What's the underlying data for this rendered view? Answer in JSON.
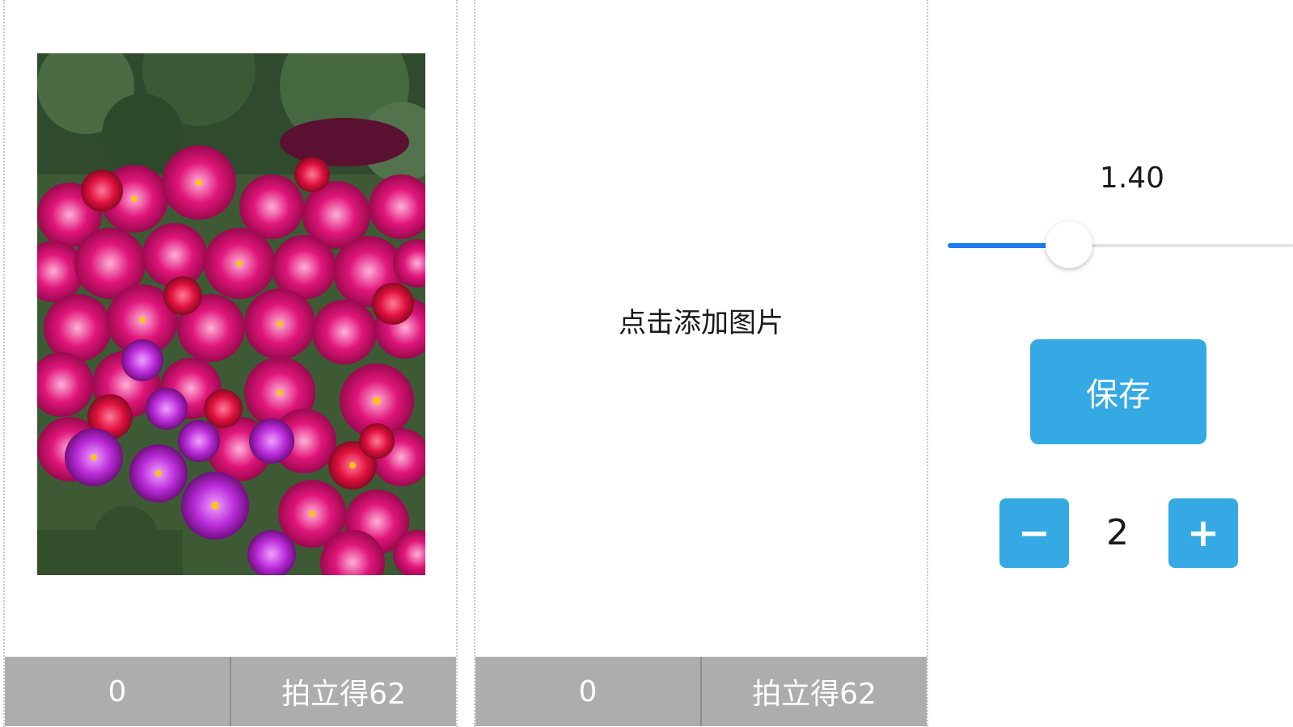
{
  "left_card": {
    "photo_icon": "flower-field-photo",
    "footer": {
      "count": "0",
      "size_label": "拍立得62"
    }
  },
  "middle_card": {
    "placeholder_text": "点击添加图片",
    "footer": {
      "count": "0",
      "size_label": "拍立得62"
    }
  },
  "controls": {
    "slider_value": "1.40",
    "slider_fraction": 0.35,
    "save_label": "保存",
    "decrement_label": "−",
    "increment_label": "+",
    "quantity": "2"
  },
  "colors": {
    "accent": "#34a9e3",
    "slider_fill": "#1a7cf0",
    "footer_bg": "#adadad"
  }
}
